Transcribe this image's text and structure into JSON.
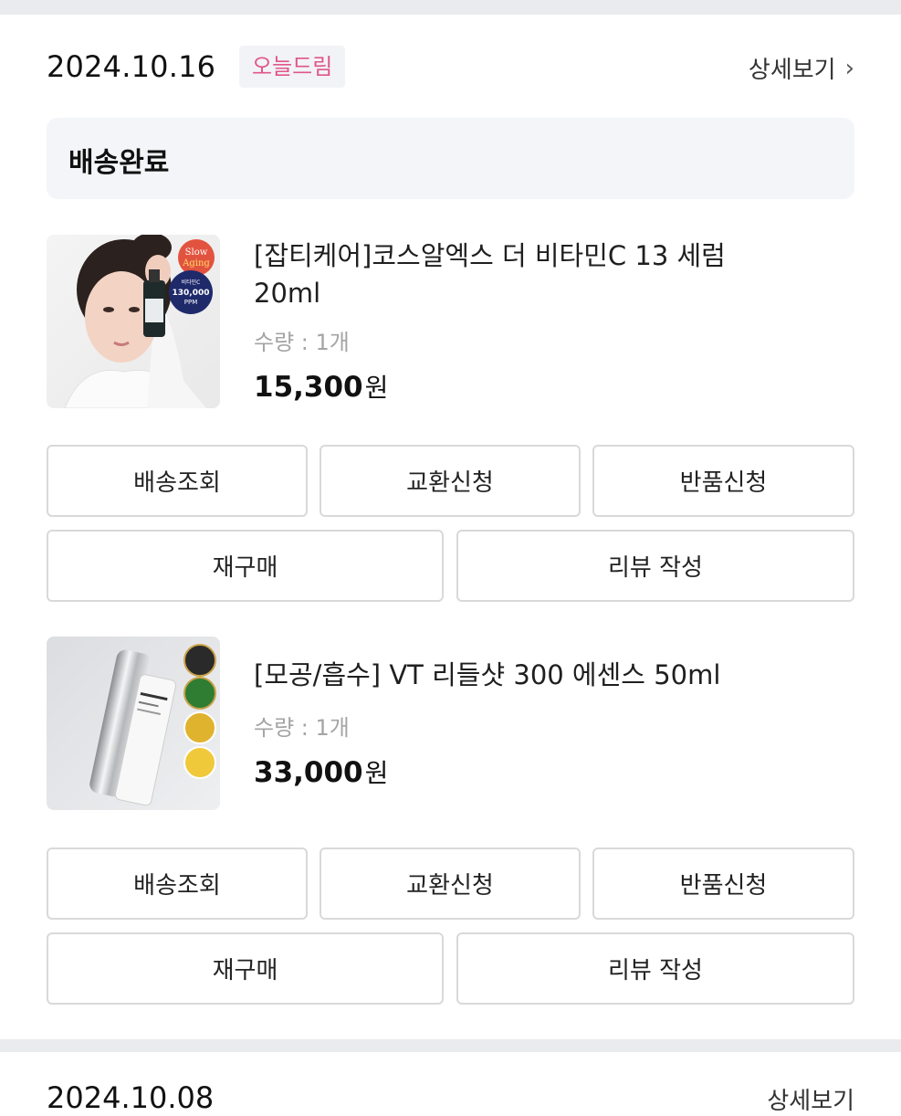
{
  "order": {
    "date": "2024.10.16",
    "store_badge": "오늘드림",
    "detail_link": "상세보기",
    "status": "배송완료"
  },
  "items": [
    {
      "name_line1": "[잡티케어]코스알엑스 더 비타민C 13 세럼",
      "name_line2": "20ml",
      "quantity": "수량 : 1개",
      "price": "15,300",
      "currency": "원",
      "thumb_badge_top": "Slow",
      "thumb_badge_bottom": "Aging",
      "thumb_badge2_lines": [
        "비타민C",
        "130,000",
        "PPM"
      ]
    },
    {
      "name_line1": "[모공/흡수] VT 리들샷 300 에센스 50ml",
      "quantity": "수량 : 1개",
      "price": "33,000",
      "currency": "원"
    }
  ],
  "buttons": {
    "track": "배송조회",
    "exchange": "교환신청",
    "return": "반품신청",
    "rebuy": "재구매",
    "review": "리뷰 작성"
  },
  "next_order": {
    "date_peek": "2024.10.08",
    "detail_peek": "상세보기"
  }
}
